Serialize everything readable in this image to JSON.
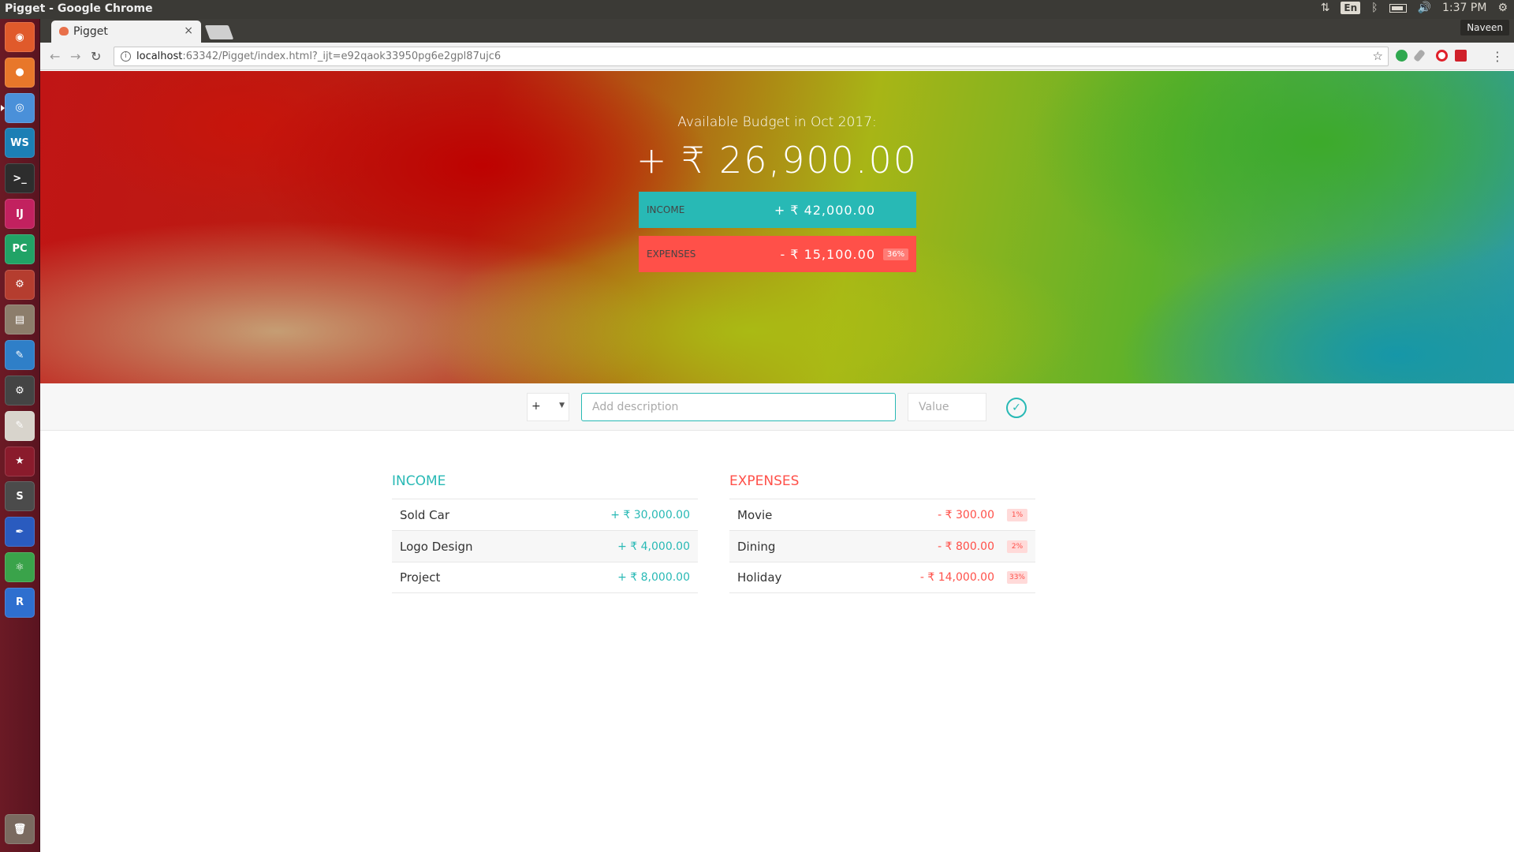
{
  "os": {
    "window_title": "Pigget - Google Chrome",
    "keyboard_lang": "En",
    "clock": "1:37 PM",
    "user": "Naveen"
  },
  "launcher": {
    "apps": [
      {
        "name": "ubuntu-dash-icon",
        "color": "#e05a2b",
        "glyph": "◉"
      },
      {
        "name": "firefox-icon",
        "color": "#e8772a",
        "glyph": "●"
      },
      {
        "name": "chrome-icon",
        "color": "#4a90d9",
        "glyph": "◎"
      },
      {
        "name": "webstorm-icon",
        "color": "#1c7fb5",
        "glyph": "WS"
      },
      {
        "name": "terminal-icon",
        "color": "#2d2d2d",
        "glyph": ">_"
      },
      {
        "name": "intellij-icon",
        "color": "#c2215f",
        "glyph": "IJ"
      },
      {
        "name": "pycharm-icon",
        "color": "#21a366",
        "glyph": "PC"
      },
      {
        "name": "system-settings-icon",
        "color": "#b53d2f",
        "glyph": "⚙"
      },
      {
        "name": "files-icon",
        "color": "#8c7d6b",
        "glyph": "▤"
      },
      {
        "name": "software-updater-icon",
        "color": "#2f7fc8",
        "glyph": "✎"
      },
      {
        "name": "gear-tool-icon",
        "color": "#444444",
        "glyph": "⚙"
      },
      {
        "name": "text-editor-icon",
        "color": "#d8d4cc",
        "glyph": "✎"
      },
      {
        "name": "star-app-icon",
        "color": "#8a1b2c",
        "glyph": "★"
      },
      {
        "name": "sublime-text-icon",
        "color": "#4b4b4b",
        "glyph": "S"
      },
      {
        "name": "inkscape-icon",
        "color": "#2a5bbf",
        "glyph": "✒"
      },
      {
        "name": "atom-icon",
        "color": "#3aa34a",
        "glyph": "⚛"
      },
      {
        "name": "r-studio-icon",
        "color": "#2e6fcf",
        "glyph": "R"
      }
    ],
    "trash_glyph": "🗑"
  },
  "browser": {
    "tab_title": "Pigget",
    "tab_close": "×",
    "url_host": "localhost",
    "url_rest": ":63342/Pigget/index.html?_ijt=e92qaok33950pg6e2gpl87ujc6"
  },
  "budget": {
    "title": "Available Budget in Oct 2017:",
    "value": "+ ₹ 26,900.00",
    "income_label": "Income",
    "income_value": "+ ₹ 42,000.00",
    "expenses_label": "Expenses",
    "expenses_value": "- ₹ 15,100.00",
    "expenses_percentage": "36%"
  },
  "colors": {
    "income": "#28b9b5",
    "expenses": "#ff5049"
  },
  "add_form": {
    "type_value": "+",
    "description_placeholder": "Add description",
    "value_placeholder": "Value",
    "submit_glyph": "✓"
  },
  "income": {
    "heading": "Income",
    "items": [
      {
        "description": "Sold Car",
        "value": "+ ₹ 30,000.00"
      },
      {
        "description": "Logo Design",
        "value": "+ ₹ 4,000.00"
      },
      {
        "description": "Project",
        "value": "+ ₹ 8,000.00"
      }
    ]
  },
  "expenses": {
    "heading": "Expenses",
    "items": [
      {
        "description": "Movie",
        "value": "- ₹ 300.00",
        "percentage": "1%"
      },
      {
        "description": "Dining",
        "value": "- ₹ 800.00",
        "percentage": "2%"
      },
      {
        "description": "Holiday",
        "value": "- ₹ 14,000.00",
        "percentage": "33%"
      }
    ]
  }
}
